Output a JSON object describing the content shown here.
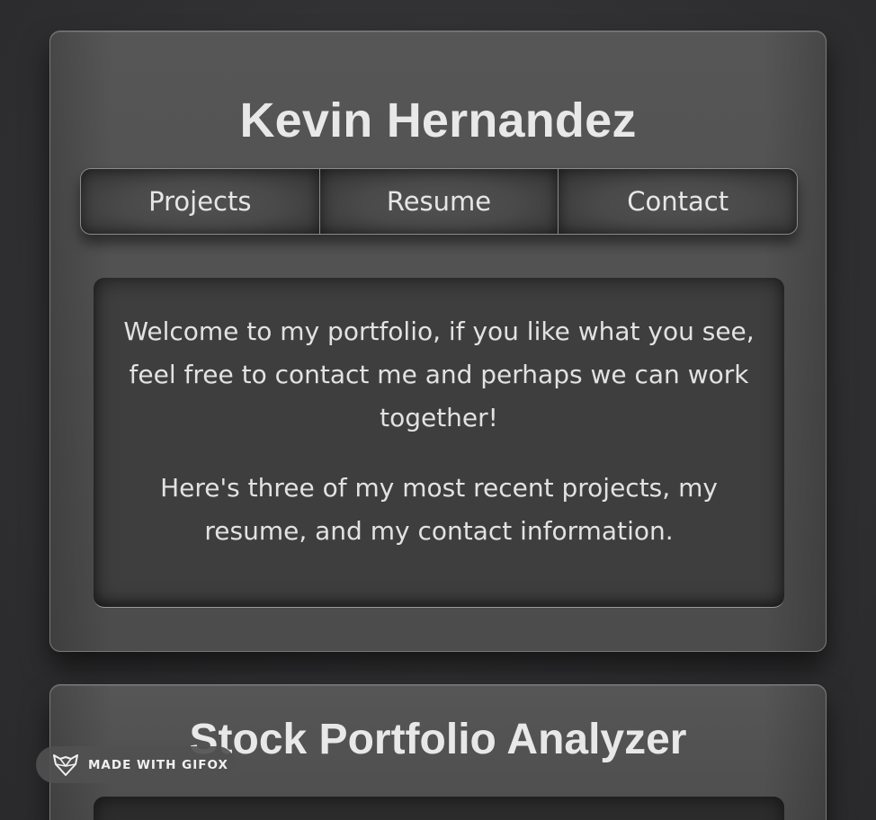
{
  "intro_card": {
    "name": "Kevin Hernandez",
    "nav": {
      "projects_label": "Projects",
      "resume_label": "Resume",
      "contact_label": "Contact"
    },
    "welcome_paragraph_1": "Welcome to my portfolio, if you like what you see, feel free to contact me and perhaps we can work together!",
    "welcome_paragraph_2": "Here's three of my most recent projects, my resume, and my contact information."
  },
  "project_card": {
    "title": "Stock Portfolio Analyzer"
  },
  "watermark": {
    "label": "MADE WITH GIFOX",
    "icon": "fox-logo-icon"
  },
  "colors": {
    "background": "#2f2f31",
    "card": "#525252",
    "inner_panel": "#3e3e3e",
    "text": "#e4e4e4"
  }
}
